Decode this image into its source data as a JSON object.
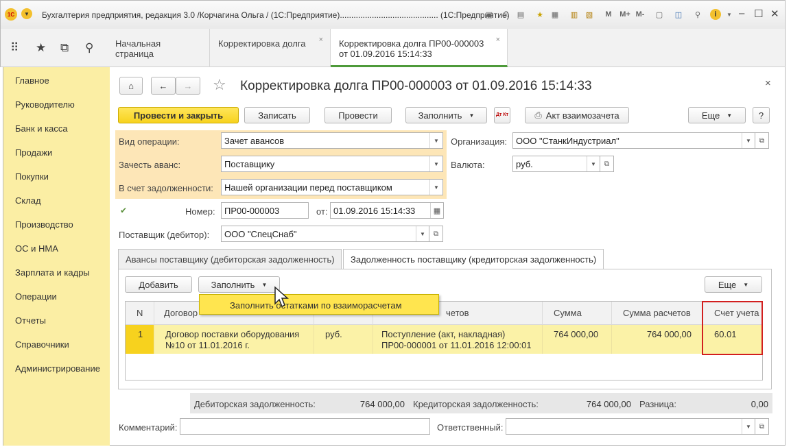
{
  "app": {
    "window_title": "Бухгалтерия предприятия, редакция 3.0 /Корчагина Ольга / (1С:Предприятие)...........................................  (1С:Предприятие)",
    "toolbar_text_buttons": {
      "m": "M",
      "mplus": "M+",
      "mminus": "M-"
    },
    "window_controls": {
      "minimize": "–",
      "maximize": "☐",
      "close": "✕"
    }
  },
  "tabs": [
    {
      "label": "Начальная страница"
    },
    {
      "label": "Корректировка долга",
      "close": "×"
    },
    {
      "label_line1": "Корректировка долга ПР00-000003",
      "label_line2": "от 01.09.2016 15:14:33",
      "close": "×"
    }
  ],
  "sidebar": {
    "items": [
      {
        "label": "Главное"
      },
      {
        "label": "Руководителю"
      },
      {
        "label": "Банк и касса"
      },
      {
        "label": "Продажи"
      },
      {
        "label": "Покупки"
      },
      {
        "label": "Склад"
      },
      {
        "label": "Производство"
      },
      {
        "label": "ОС и НМА"
      },
      {
        "label": "Зарплата и кадры"
      },
      {
        "label": "Операции"
      },
      {
        "label": "Отчеты"
      },
      {
        "label": "Справочники"
      },
      {
        "label": "Администрирование"
      }
    ]
  },
  "document": {
    "title": "Корректировка долга ПР00-000003 от 01.09.2016 15:14:33",
    "close": "×"
  },
  "commandbar": {
    "post_close": "Провести и закрыть",
    "save": "Записать",
    "post": "Провести",
    "fill": "Заполнить",
    "dtkt": "Дт Кт",
    "act": "Акт взаимозачета",
    "more": "Еще",
    "help": "?"
  },
  "form": {
    "operation_label": "Вид операции:",
    "operation_value": "Зачет авансов",
    "offset_label": "Зачесть аванс:",
    "offset_value": "Поставщику",
    "debt_label": "В счет задолженности:",
    "debt_value": "Нашей организации перед поставщиком",
    "org_label": "Организация:",
    "org_value": "ООО \"СтанкИндустриал\"",
    "currency_label": "Валюта:",
    "currency_value": "руб.",
    "number_label": "Номер:",
    "number_value": "ПР00-000003",
    "date_label": "от:",
    "date_value": "01.09.2016 15:14:33",
    "supplier_label": "Поставщик (дебитор):",
    "supplier_value": "ООО \"СпецСнаб\"",
    "comment_label": "Комментарий:",
    "comment_value": "",
    "responsible_label": "Ответственный:",
    "responsible_value": ""
  },
  "subtabs": [
    {
      "label": "Авансы поставщику (дебиторская задолженность)"
    },
    {
      "label": "Задолженность поставщику (кредиторская задолженность)"
    }
  ],
  "tablebar": {
    "add": "Добавить",
    "fill": "Заполнить",
    "more": "Еще",
    "popup_item": "Заполнить остатками по взаиморасчетам"
  },
  "table": {
    "headers": {
      "n": "N",
      "contract": "Договор",
      "currency": "",
      "document": "четов",
      "amount": "Сумма",
      "settlement_amount": "Сумма расчетов",
      "account": "Счет учета"
    },
    "rows": [
      {
        "n": "1",
        "contract_line1": "Договор поставки оборудования",
        "contract_line2": "№10 от 11.01.2016 г.",
        "currency": "руб.",
        "document_line1": "Поступление (акт, накладная)",
        "document_line2": "ПР00-000001 от 11.01.2016 12:00:01",
        "amount": "764 000,00",
        "settlement_amount": "764 000,00",
        "account": "60.01"
      }
    ]
  },
  "totals": {
    "debit_label": "Дебиторская задолженность:",
    "debit_value": "764 000,00",
    "credit_label": "Кредиторская задолженность:",
    "credit_value": "764 000,00",
    "diff_label": "Разница:",
    "diff_value": "0,00"
  },
  "colors": {
    "sidebar_bg": "#fbeea4",
    "primary_button": "#f7d21e",
    "operation_group_bg": "#fde6b7",
    "selected_row": "#fbf2a7",
    "highlight_frame": "#d21f1f",
    "active_tab_underline": "#4e9a3a"
  },
  "icons": [
    "app-logo-icon",
    "menu-icon",
    "apps-grid-icon",
    "star-icon",
    "history-icon",
    "search-icon",
    "home-icon",
    "back-arrow-icon",
    "forward-arrow-icon",
    "favorite-star-icon",
    "printer-icon",
    "calendar-icon",
    "open-icon",
    "posted-document-icon",
    "dropdown-arrow-icon",
    "cursor-icon"
  ]
}
